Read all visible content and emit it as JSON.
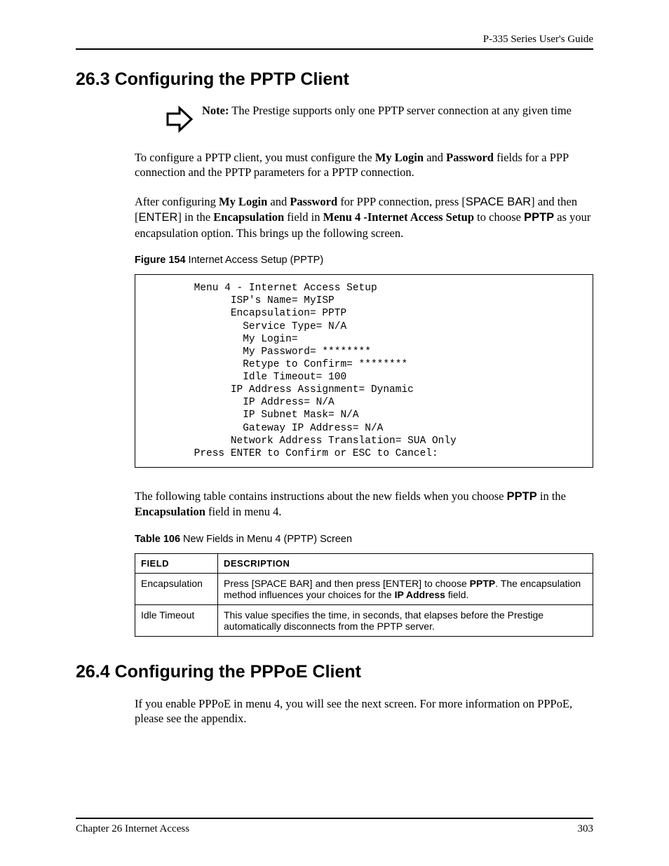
{
  "header": {
    "guide": "P-335 Series User's Guide"
  },
  "section263": {
    "title": "26.3  Configuring the PPTP Client",
    "note_bold": "Note:",
    "note_rest": " The Prestige supports only one PPTP server connection at any given time",
    "para1_a": "To configure a PPTP client, you must configure the ",
    "para1_b": "My Login",
    "para1_c": " and ",
    "para1_d": "Password",
    "para1_e": " fields for a PPP connection and the PPTP parameters for a PPTP connection.",
    "para2_a": "After configuring ",
    "para2_b": "My Login",
    "para2_c": " and ",
    "para2_d": "Password",
    "para2_e": " for PPP connection, press [",
    "para2_f": "SPACE BAR",
    "para2_g": "] and then [",
    "para2_h": "ENTER",
    "para2_i": "] in the ",
    "para2_j": "Encapsulation",
    "para2_k": " field in ",
    "para2_l": "Menu 4 -Internet Access Setup",
    "para2_m": " to choose ",
    "para2_n": "PPTP",
    "para2_o": " as your encapsulation option. This brings up the following screen.",
    "figure_num": "Figure 154",
    "figure_caption": "   Internet Access Setup (PPTP)",
    "menu_text": "        Menu 4 - Internet Access Setup\n              ISP's Name= MyISP\n              Encapsulation= PPTP\n                Service Type= N/A\n                My Login=\n                My Password= ********\n                Retype to Confirm= ********\n                Idle Timeout= 100\n              IP Address Assignment= Dynamic\n                IP Address= N/A\n                IP Subnet Mask= N/A\n                Gateway IP Address= N/A\n              Network Address Translation= SUA Only\n        Press ENTER to Confirm or ESC to Cancel:",
    "para3_a": "The following table contains instructions about the new fields when you choose ",
    "para3_b": "PPTP",
    "para3_c": " in the ",
    "para3_d": "Encapsulation",
    "para3_e": " field in menu 4.",
    "table_num": "Table 106",
    "table_caption": "   New Fields in Menu 4 (PPTP) Screen",
    "table": {
      "head_field": "FIELD",
      "head_desc": "DESCRIPTION",
      "rows": [
        {
          "field": "Encapsulation",
          "d1": "Press [SPACE BAR] and then press [ENTER] to choose ",
          "d2": "PPTP",
          "d3": ". The encapsulation method influences your choices for the ",
          "d4": "IP Address",
          "d5": " field."
        },
        {
          "field": "Idle Timeout",
          "d1": "This value specifies the time, in seconds, that elapses before the Prestige automatically disconnects from the PPTP server.",
          "d2": "",
          "d3": "",
          "d4": "",
          "d5": ""
        }
      ]
    }
  },
  "section264": {
    "title": "26.4  Configuring the PPPoE Client",
    "para1": "If you enable PPPoE in menu 4, you will see the next screen. For more information on PPPoE, please see the appendix."
  },
  "footer": {
    "chapter": "Chapter 26 Internet Access",
    "page": "303"
  },
  "chart_data": null
}
